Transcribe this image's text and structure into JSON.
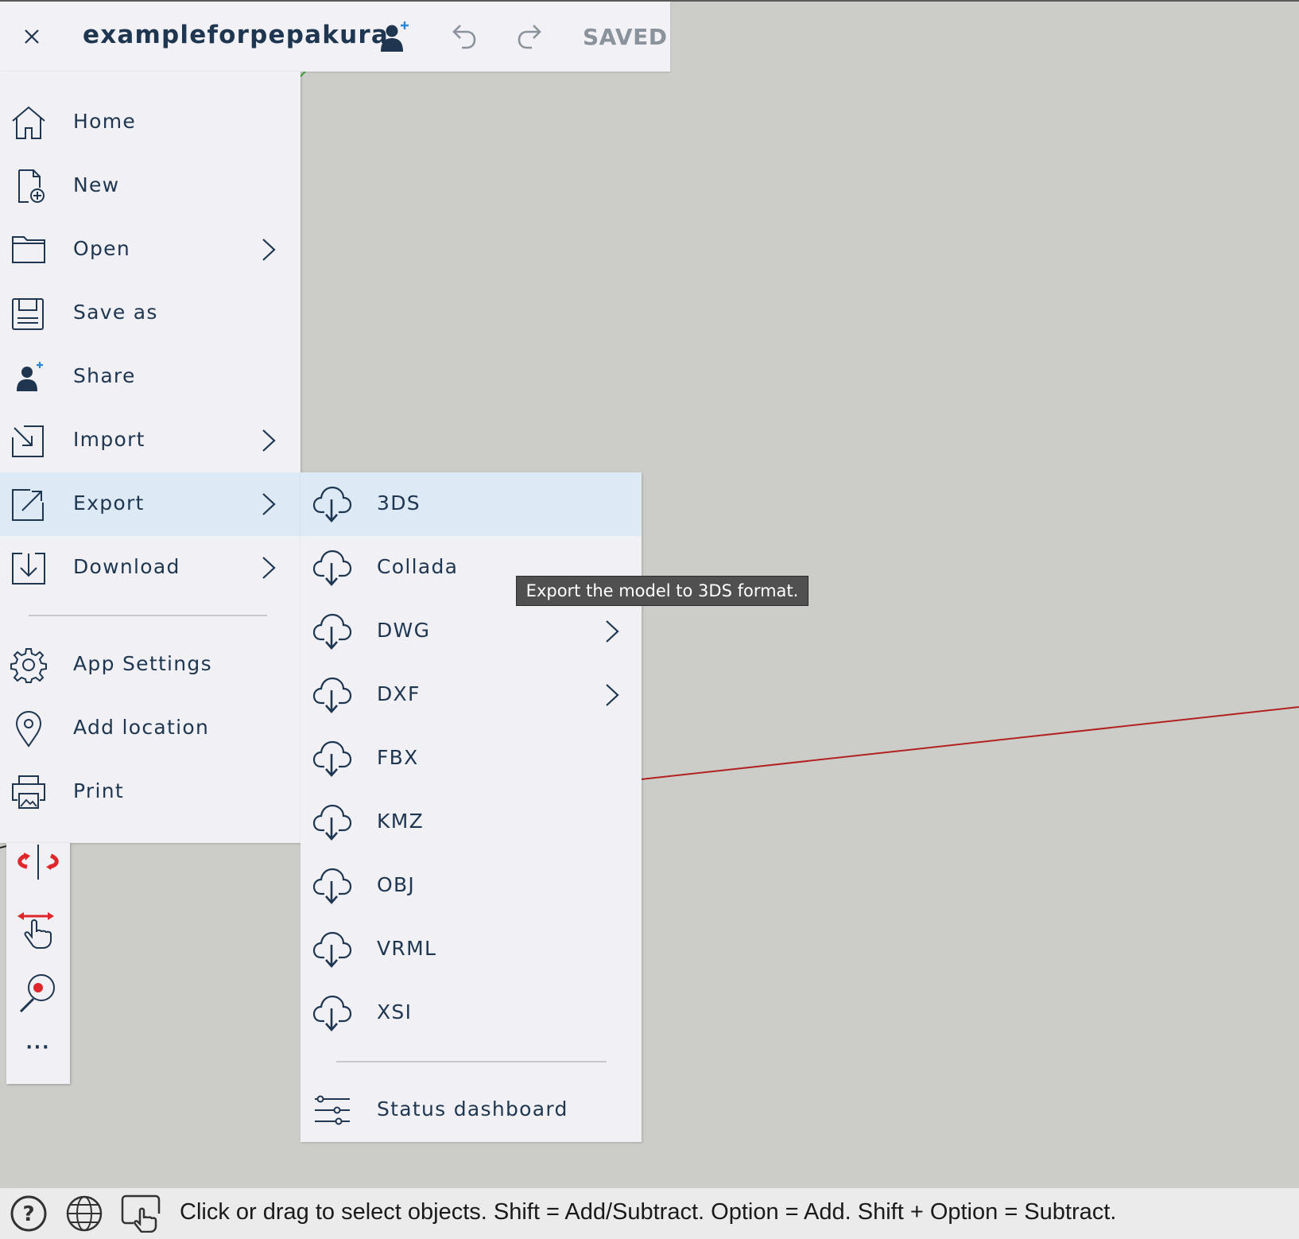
{
  "header": {
    "close_icon": "close-icon",
    "title": "exampleforpepakura",
    "share_icon": "share-user-icon",
    "undo_icon": "undo-icon",
    "redo_icon": "redo-icon",
    "status": "SAVED"
  },
  "menu": {
    "items": [
      {
        "label": "Home",
        "icon": "home-icon"
      },
      {
        "label": "New",
        "icon": "new-file-icon"
      },
      {
        "label": "Open",
        "icon": "folder-icon",
        "submenu": true
      },
      {
        "label": "Save as",
        "icon": "save-icon"
      },
      {
        "label": "Share",
        "icon": "share-user-icon"
      },
      {
        "label": "Import",
        "icon": "import-icon",
        "submenu": true
      },
      {
        "label": "Export",
        "icon": "export-icon",
        "submenu": true,
        "active": true
      },
      {
        "label": "Download",
        "icon": "download-icon",
        "submenu": true
      },
      {
        "label": "App Settings",
        "icon": "gear-icon"
      },
      {
        "label": "Add location",
        "icon": "location-pin-icon"
      },
      {
        "label": "Print",
        "icon": "print-icon"
      }
    ]
  },
  "export_submenu": {
    "items": [
      {
        "label": "3DS",
        "icon": "cloud-download-icon",
        "active": true
      },
      {
        "label": "Collada",
        "icon": "cloud-download-icon"
      },
      {
        "label": "DWG",
        "icon": "cloud-download-icon",
        "submenu": true
      },
      {
        "label": "DXF",
        "icon": "cloud-download-icon",
        "submenu": true
      },
      {
        "label": "FBX",
        "icon": "cloud-download-icon"
      },
      {
        "label": "KMZ",
        "icon": "cloud-download-icon"
      },
      {
        "label": "OBJ",
        "icon": "cloud-download-icon"
      },
      {
        "label": "VRML",
        "icon": "cloud-download-icon"
      },
      {
        "label": "XSI",
        "icon": "cloud-download-icon"
      }
    ],
    "status_dashboard": "Status dashboard"
  },
  "tooltip": "Export the model to 3DS format.",
  "toolbar": {
    "tools": [
      "orbit-icon",
      "pan-icon",
      "zoom-icon",
      "more-icon"
    ],
    "more_label": "···"
  },
  "statusbar": {
    "help_icon": "help-icon",
    "globe_icon": "globe-icon",
    "select_icon": "select-tool-icon",
    "message": "Click or drag to select objects. Shift = Add/Subtract. Option = Add. Shift + Option = Subtract."
  },
  "colors": {
    "canvas": "#cccdc8",
    "panel": "#f0f0f5",
    "active_row": "#dde9f5",
    "text_primary": "#1e3650",
    "axis_red": "#b22222"
  }
}
